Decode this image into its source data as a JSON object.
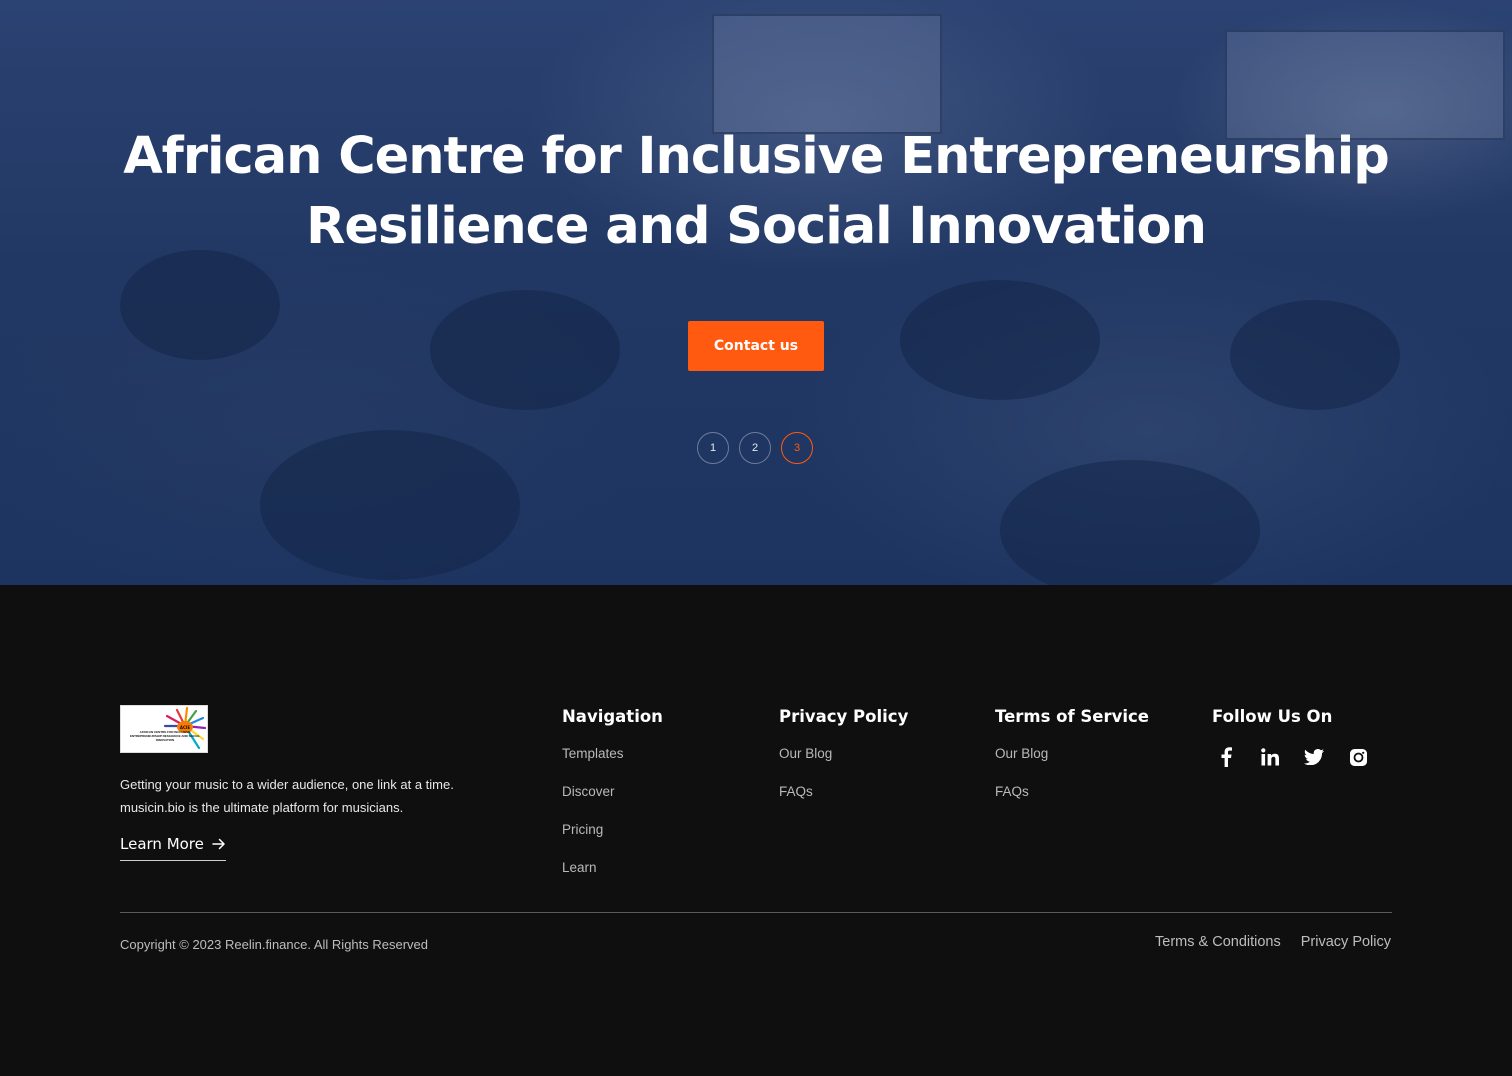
{
  "hero": {
    "title_line1": "African Centre for Inclusive Entrepreneurship",
    "title_line2": "Resilience and Social Innovation",
    "cta_label": "Contact us",
    "slides": [
      "1",
      "2",
      "3"
    ],
    "active_slide": "3"
  },
  "footer": {
    "logo_text": "AFRICAN CENTRE FOR INCLUSIVE ENTREPRENEURSHIP RESILIENCE AND SOCIAL INNOVATION",
    "description": "Getting your music to a wider audience, one link at a time. musicin.bio is the ultimate platform for musicians.",
    "learn_more_label": "Learn More",
    "columns": [
      {
        "title": "Navigation",
        "links": [
          "Templates",
          "Discover",
          "Pricing",
          "Learn"
        ]
      },
      {
        "title": "Privacy Policy",
        "links": [
          "Our Blog",
          "FAQs"
        ]
      },
      {
        "title": "Terms of Service",
        "links": [
          "Our Blog",
          "FAQs"
        ]
      }
    ],
    "follow_title": "Follow Us On",
    "social_icons": [
      "facebook-icon",
      "linkedin-icon",
      "twitter-icon",
      "instagram-icon"
    ],
    "copyright": "Copyright © 2023 Reelin.finance. All Rights Reserved",
    "legal_links": [
      "Terms & Conditions",
      "Privacy Policy"
    ]
  },
  "colors": {
    "accent": "#ff5a0f",
    "hero_overlay": "#223864",
    "footer_bg": "#0f0f10"
  }
}
